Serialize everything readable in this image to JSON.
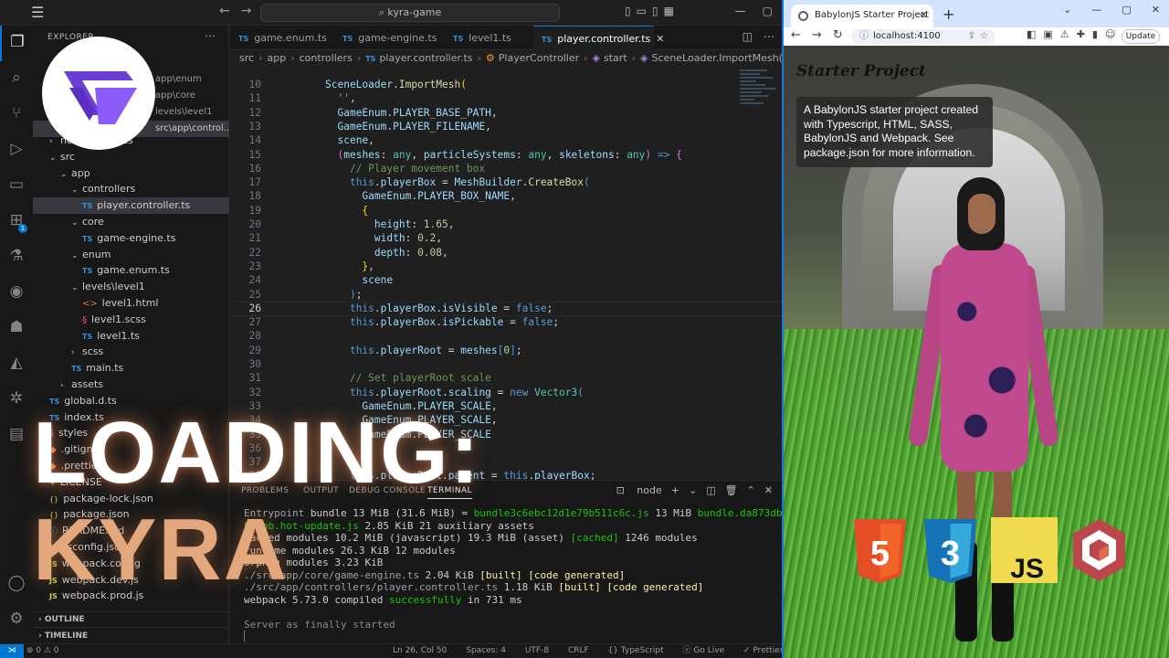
{
  "vscode": {
    "search_text": "kyra-game",
    "explorer_label": "EXPLORER",
    "open_editors": [
      "app\\enum",
      "app\\core",
      "levels\\level1",
      "src\\app\\control..."
    ],
    "tree": [
      {
        "label": "node_modules",
        "kind": "folder",
        "depth": 1,
        "open": false
      },
      {
        "label": "src",
        "kind": "folder",
        "depth": 1,
        "open": true
      },
      {
        "label": "app",
        "kind": "folder",
        "depth": 2,
        "open": true
      },
      {
        "label": "controllers",
        "kind": "folder",
        "depth": 3,
        "open": true
      },
      {
        "label": "player.controller.ts",
        "kind": "ts",
        "depth": 4,
        "selected": true
      },
      {
        "label": "core",
        "kind": "folder",
        "depth": 3,
        "open": true
      },
      {
        "label": "game-engine.ts",
        "kind": "ts",
        "depth": 4
      },
      {
        "label": "enum",
        "kind": "folder",
        "depth": 3,
        "open": true
      },
      {
        "label": "game.enum.ts",
        "kind": "ts",
        "depth": 4
      },
      {
        "label": "levels\\level1",
        "kind": "folder",
        "depth": 3,
        "open": true
      },
      {
        "label": "level1.html",
        "kind": "html",
        "depth": 4
      },
      {
        "label": "level1.scss",
        "kind": "scss",
        "depth": 4
      },
      {
        "label": "level1.ts",
        "kind": "ts",
        "depth": 4
      },
      {
        "label": "scss",
        "kind": "folder",
        "depth": 3,
        "open": false
      },
      {
        "label": "main.ts",
        "kind": "ts",
        "depth": 3
      },
      {
        "label": "assets",
        "kind": "folder",
        "depth": 2,
        "open": false
      },
      {
        "label": "global.d.ts",
        "kind": "ts",
        "depth": 1
      },
      {
        "label": "index.ts",
        "kind": "ts",
        "depth": 1
      },
      {
        "label": "styles",
        "kind": "scss",
        "depth": 1
      },
      {
        "label": ".gitign",
        "kind": "git",
        "depth": 1
      },
      {
        "label": ".prettier",
        "kind": "git",
        "depth": 1
      },
      {
        "label": "LICENSE",
        "kind": "lic",
        "depth": 1
      },
      {
        "label": "package-lock.json",
        "kind": "json",
        "depth": 1
      },
      {
        "label": "package.json",
        "kind": "json",
        "depth": 1
      },
      {
        "label": "README.md",
        "kind": "md",
        "depth": 1
      },
      {
        "label": "tsconfig.json",
        "kind": "json",
        "depth": 1
      },
      {
        "label": "webpack.config",
        "kind": "js",
        "depth": 1
      },
      {
        "label": "webpack.dev.js",
        "kind": "js",
        "depth": 1
      },
      {
        "label": "webpack.prod.js",
        "kind": "js",
        "depth": 1
      }
    ],
    "outline_label": "OUTLINE",
    "timeline_label": "TIMELINE",
    "tabs": [
      {
        "label": "game.enum.ts",
        "active": false
      },
      {
        "label": "game-engine.ts",
        "active": false
      },
      {
        "label": "level1.ts",
        "active": false
      },
      {
        "label": "player.controller.ts",
        "active": true
      }
    ],
    "breadcrumbs": [
      "src",
      "app",
      "controllers",
      "player.controller.ts",
      "PlayerController",
      "start",
      "SceneLoader.ImportMesh(\") callback"
    ],
    "code_lines": [
      {
        "n": 10,
        "html": "<span class=\"v\">SceneLoader</span><span class=\"p\">.</span><span class=\"f\">ImportMesh</span><span class=\"y\">(</span>"
      },
      {
        "n": 11,
        "html": "  <span class=\"s\">''</span><span class=\"p\">,</span>"
      },
      {
        "n": 12,
        "html": "  <span class=\"v\">GameEnum</span><span class=\"p\">.</span><span class=\"v\">PLAYER_BASE_PATH</span><span class=\"p\">,</span>"
      },
      {
        "n": 13,
        "html": "  <span class=\"v\">GameEnum</span><span class=\"p\">.</span><span class=\"v\">PLAYER_FILENAME</span><span class=\"p\">,</span>"
      },
      {
        "n": 14,
        "html": "  <span class=\"v\">scene</span><span class=\"p\">,</span>"
      },
      {
        "n": 15,
        "html": "  <span class=\"m\">(</span><span class=\"v\">meshes</span><span class=\"p\">: </span><span class=\"t\">any</span><span class=\"p\">, </span><span class=\"v\">particleSystems</span><span class=\"p\">: </span><span class=\"t\">any</span><span class=\"p\">, </span><span class=\"v\">skeletons</span><span class=\"p\">: </span><span class=\"t\">any</span><span class=\"m\">)</span><span class=\"k\"> =&gt; </span><span class=\"m\">{</span>"
      },
      {
        "n": 16,
        "html": "    <span class=\"c\">// Player movement box</span>"
      },
      {
        "n": 17,
        "html": "    <span class=\"k\">this</span><span class=\"p\">.</span><span class=\"v\">playerBox</span><span class=\"p\"> = </span><span class=\"v\">MeshBuilder</span><span class=\"p\">.</span><span class=\"f\">CreateBox</span><span class=\"k\">(</span>"
      },
      {
        "n": 18,
        "html": "      <span class=\"v\">GameEnum</span><span class=\"p\">.</span><span class=\"v\">PLAYER_BOX_NAME</span><span class=\"p\">,</span>"
      },
      {
        "n": 19,
        "html": "      <span class=\"y\">{</span>"
      },
      {
        "n": 20,
        "html": "        <span class=\"v\">height</span><span class=\"p\">: </span><span class=\"n\">1.65</span><span class=\"p\">,</span>"
      },
      {
        "n": 21,
        "html": "        <span class=\"v\">width</span><span class=\"p\">: </span><span class=\"n\">0.2</span><span class=\"p\">,</span>"
      },
      {
        "n": 22,
        "html": "        <span class=\"v\">depth</span><span class=\"p\">: </span><span class=\"n\">0.08</span><span class=\"p\">,</span>"
      },
      {
        "n": 23,
        "html": "      <span class=\"y\">}</span><span class=\"p\">,</span>"
      },
      {
        "n": 24,
        "html": "      <span class=\"v\">scene</span>"
      },
      {
        "n": 25,
        "html": "    <span class=\"k\">)</span><span class=\"p\">;</span>"
      },
      {
        "n": 26,
        "html": "    <span class=\"k\">this</span><span class=\"p\">.</span><span class=\"v\">playerBox</span><span class=\"p\">.</span><span class=\"v\">isVisible</span><span class=\"p\"> = </span><span class=\"k\">false</span><span class=\"p\">;</span>"
      },
      {
        "n": 27,
        "html": "    <span class=\"k\">this</span><span class=\"p\">.</span><span class=\"v\">playerBox</span><span class=\"p\">.</span><span class=\"v\">isPickable</span><span class=\"p\"> = </span><span class=\"k\">false</span><span class=\"p\">;</span>"
      },
      {
        "n": 28,
        "html": ""
      },
      {
        "n": 29,
        "html": "    <span class=\"k\">this</span><span class=\"p\">.</span><span class=\"v\">playerRoot</span><span class=\"p\"> = </span><span class=\"v\">meshes</span><span class=\"k\">[</span><span class=\"n\">0</span><span class=\"k\">]</span><span class=\"p\">;</span>"
      },
      {
        "n": 30,
        "html": ""
      },
      {
        "n": 31,
        "html": "    <span class=\"c\">// Set playerRoot scale</span>"
      },
      {
        "n": 32,
        "html": "    <span class=\"k\">this</span><span class=\"p\">.</span><span class=\"v\">playerRoot</span><span class=\"p\">.</span><span class=\"v\">scaling</span><span class=\"p\"> = </span><span class=\"k\">new </span><span class=\"t\">Vector3</span><span class=\"k\">(</span>"
      },
      {
        "n": 33,
        "html": "      <span class=\"v\">GameEnum</span><span class=\"p\">.</span><span class=\"v\">PLAYER_SCALE</span><span class=\"p\">,</span>"
      },
      {
        "n": 34,
        "html": "      <span class=\"v\">GameEnum</span><span class=\"p\">.</span><span class=\"v\">PLAYER_SCALE</span><span class=\"p\">,</span>"
      },
      {
        "n": 35,
        "html": "      <span class=\"v\">GameEnum</span><span class=\"p\">.</span><span class=\"v\">PLAYER_SCALE</span>"
      },
      {
        "n": 36,
        "html": ""
      },
      {
        "n": 37,
        "html": ""
      },
      {
        "n": 38,
        "html": "    <span class=\"k\">this</span><span class=\"p\">.</span><span class=\"v\">playerRoot</span><span class=\"p\">.</span><span class=\"v\">parent</span><span class=\"p\"> = </span><span class=\"k\">this</span><span class=\"p\">.</span><span class=\"v\">playerBox</span><span class=\"p\">;</span>"
      }
    ],
    "current_line": 26,
    "panel_tabs": [
      "PROBLEMS",
      "OUTPUT",
      "DEBUG CONSOLE",
      "TERMINAL"
    ],
    "terminal_shell": "node",
    "terminal_lines": [
      "<span class=\"dim\">Entrypoint</span> <span>bundle</span> 13 MiB (31.6 MiB) = <span class=\"g\">bundle3c6ebc12d1e79b511c6c.js</span> 13 MiB <span class=\"g\">bundle.da873dbc3b8b5</span>",
      "<span class=\"g\">bb1bb.hot-update.js</span> 2.85 KiB 21 auxiliary assets",
      "cached modules 10.2 MiB (javascript) 19.3 MiB (asset) <span class=\"g\">[cached]</span> 1246 modules",
      "runtime modules 26.3 KiB 12 modules",
      "orphan modules 3.23 KiB",
      "<span class=\"dim\">./src/app/core/game-engine.ts</span> 2.04 KiB <span class=\"yb\">[built]</span> <span class=\"yb\">[code generated]</span>",
      "<span class=\"dim\">./src/app/controllers/player.controller.ts</span> 1.18 KiB <span class=\"yb\">[built]</span> <span class=\"yb\">[code generated]</span>",
      "webpack 5.73.0 compiled <span class=\"g\">successfully</span> in 731 ms",
      "",
      "<span class=\"gr\">Server as finally started</span>",
      "<span class=\"gr\">▏</span>"
    ],
    "status": {
      "problems": "⊗ 0 ⚠ 0",
      "cursor": "Ln 26, Col 50",
      "spaces": "Spaces: 4",
      "encoding": "UTF-8",
      "eol": "CRLF",
      "language": "{} TypeScript",
      "golive": "ⓥ Go Live",
      "prettier": "✓ Prettier"
    }
  },
  "overlay": {
    "loading_line1": "LOADING:",
    "loading_line2": "KYRA"
  },
  "browser": {
    "tab_title": "BabylonJS Starter Project",
    "url": "localhost:4100",
    "update_label": "Update",
    "page_title": "Starter Project",
    "info_text": "A BabylonJS starter project created with Typescript, HTML, SASS, BabylonJS and Webpack. See package.json for more information.",
    "tech_badges": [
      {
        "label": "HTML5",
        "glyph": "5",
        "color": "#e44d26"
      },
      {
        "label": "CSS3",
        "glyph": "3",
        "color": "#1572b6"
      },
      {
        "label": "JS",
        "glyph": "JS",
        "color": "#f0db4f"
      },
      {
        "label": "BabylonJS",
        "glyph": "",
        "color": "#bb464b"
      }
    ]
  },
  "colors": {
    "accent": "#0078d4",
    "brand_logo": "#6b3fd4"
  }
}
